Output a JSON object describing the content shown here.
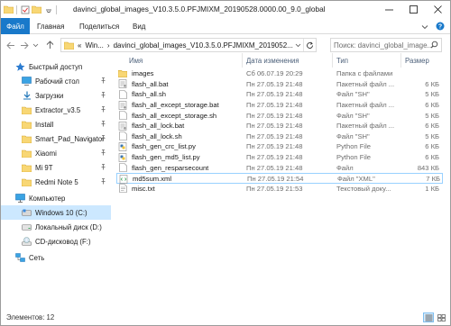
{
  "window": {
    "title": "davinci_global_images_V10.3.5.0.PFJMIXM_20190528.0000.00_9.0_global"
  },
  "ribbon": {
    "file_tab": "Файл",
    "tabs": [
      "Главная",
      "Поделиться",
      "Вид"
    ]
  },
  "address": {
    "prefix": "«",
    "segments": [
      "Win...",
      "davinci_global_images_V10.3.5.0.PFJMIXM_2019052..."
    ],
    "separator": "›"
  },
  "search": {
    "placeholder": "Поиск: davinci_global_image..."
  },
  "nav": {
    "quick_access": "Быстрый доступ",
    "items": [
      {
        "label": "Рабочий стол",
        "icon": "desktop-icon",
        "pinned": true
      },
      {
        "label": "Загрузки",
        "icon": "downloads-icon",
        "pinned": true
      },
      {
        "label": "Extractor_v3.5",
        "icon": "folder-icon",
        "pinned": true
      },
      {
        "label": "Install",
        "icon": "folder-icon",
        "pinned": true
      },
      {
        "label": "Smart_Pad_Navigator",
        "icon": "folder-icon",
        "pinned": true
      },
      {
        "label": "Xiaomi",
        "icon": "folder-icon",
        "pinned": true
      },
      {
        "label": "Mi 9T",
        "icon": "folder-icon",
        "pinned": true
      },
      {
        "label": "Redmi Note 5",
        "icon": "folder-icon",
        "pinned": true
      }
    ],
    "computer": "Компьютер",
    "drives": [
      {
        "label": "Windows 10 (C:)",
        "icon": "drive-c-icon",
        "selected": true
      },
      {
        "label": "Локальный диск (D:)",
        "icon": "drive-icon",
        "selected": false
      },
      {
        "label": "CD-дисковод (F:)",
        "icon": "cd-drive-icon",
        "selected": false
      }
    ],
    "network": "Сеть"
  },
  "columns": {
    "name": "Имя",
    "date": "Дата изменения",
    "type": "Тип",
    "size": "Размер"
  },
  "files": [
    {
      "name": "images",
      "date": "Сб 06.07.19 20:29",
      "type": "Папка с файлами",
      "size": "",
      "icon": "folder-icon"
    },
    {
      "name": "flash_all.bat",
      "date": "Пн 27.05.19 21:48",
      "type": "Пакетный файл ...",
      "size": "6 КБ",
      "icon": "bat-file-icon"
    },
    {
      "name": "flash_all.sh",
      "date": "Пн 27.05.19 21:48",
      "type": "Файл \"SH\"",
      "size": "5 КБ",
      "icon": "file-icon"
    },
    {
      "name": "flash_all_except_storage.bat",
      "date": "Пн 27.05.19 21:48",
      "type": "Пакетный файл ...",
      "size": "6 КБ",
      "icon": "bat-file-icon"
    },
    {
      "name": "flash_all_except_storage.sh",
      "date": "Пн 27.05.19 21:48",
      "type": "Файл \"SH\"",
      "size": "5 КБ",
      "icon": "file-icon"
    },
    {
      "name": "flash_all_lock.bat",
      "date": "Пн 27.05.19 21:48",
      "type": "Пакетный файл ...",
      "size": "6 КБ",
      "icon": "bat-file-icon"
    },
    {
      "name": "flash_all_lock.sh",
      "date": "Пн 27.05.19 21:48",
      "type": "Файл \"SH\"",
      "size": "5 КБ",
      "icon": "file-icon"
    },
    {
      "name": "flash_gen_crc_list.py",
      "date": "Пн 27.05.19 21:48",
      "type": "Python File",
      "size": "6 КБ",
      "icon": "python-file-icon"
    },
    {
      "name": "flash_gen_md5_list.py",
      "date": "Пн 27.05.19 21:48",
      "type": "Python File",
      "size": "6 КБ",
      "icon": "python-file-icon"
    },
    {
      "name": "flash_gen_resparsecount",
      "date": "Пн 27.05.19 21:48",
      "type": "Файл",
      "size": "843 КБ",
      "icon": "file-icon"
    },
    {
      "name": "md5sum.xml",
      "date": "Пн 27.05.19 21:54",
      "type": "Файл \"XML\"",
      "size": "7 КБ",
      "icon": "xml-file-icon",
      "selected": true
    },
    {
      "name": "misc.txt",
      "date": "Пн 27.05.19 21:53",
      "type": "Текстовый доку...",
      "size": "1 КБ",
      "icon": "text-file-icon"
    }
  ],
  "status": {
    "items_label": "Элементов: 12"
  },
  "colors": {
    "accent": "#1979ca",
    "selection": "#cce8ff",
    "folder": "#f8d775"
  }
}
